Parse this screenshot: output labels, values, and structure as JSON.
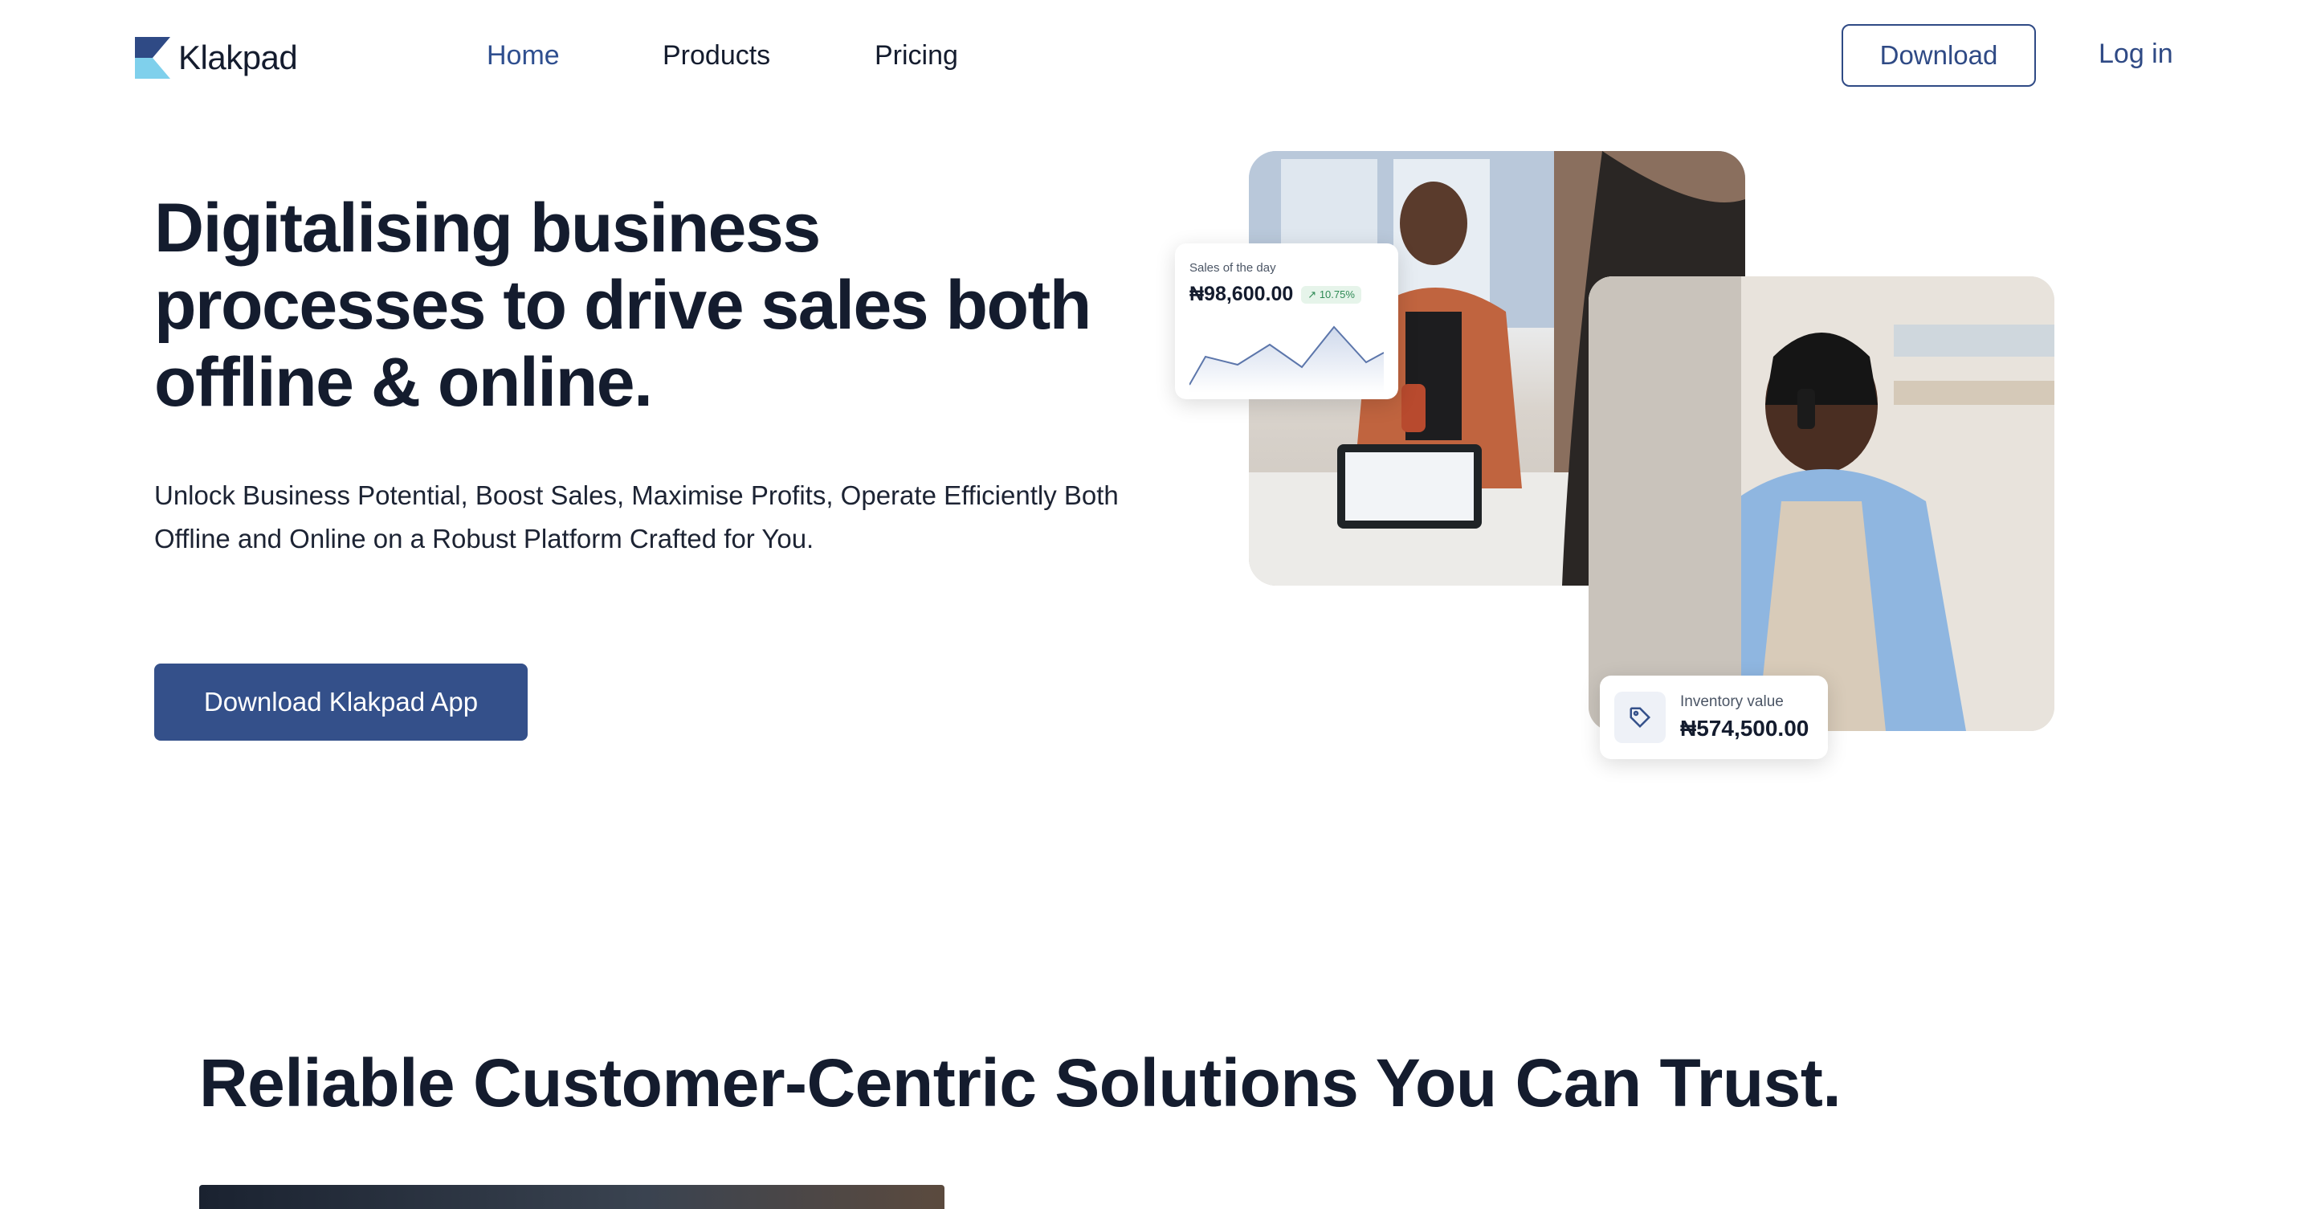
{
  "brand": {
    "name": "Klakpad"
  },
  "nav": {
    "links": [
      {
        "label": "Home",
        "active": true
      },
      {
        "label": "Products",
        "active": false
      },
      {
        "label": "Pricing",
        "active": false
      }
    ],
    "download_label": "Download",
    "login_label": "Log in"
  },
  "hero": {
    "title": "Digitalising business processes to drive sales both offline & online.",
    "subtitle": "Unlock Business Potential, Boost Sales, Maximise Profits, Operate Efficiently Both Offline and Online on a Robust Platform Crafted for You.",
    "cta_label": "Download Klakpad App"
  },
  "sales_card": {
    "label": "Sales of the day",
    "value": "₦98,600.00",
    "change": "10.75%",
    "icon": "trend-up-icon"
  },
  "inventory_card": {
    "label": "Inventory value",
    "value": "₦574,500.00",
    "icon": "tag-icon"
  },
  "section2": {
    "title": "Reliable Customer-Centric Solutions You Can Trust."
  },
  "colors": {
    "primary": "#34508a",
    "accent_text": "#2f4a85",
    "heading": "#141c2e",
    "positive": "#2f8a55"
  }
}
